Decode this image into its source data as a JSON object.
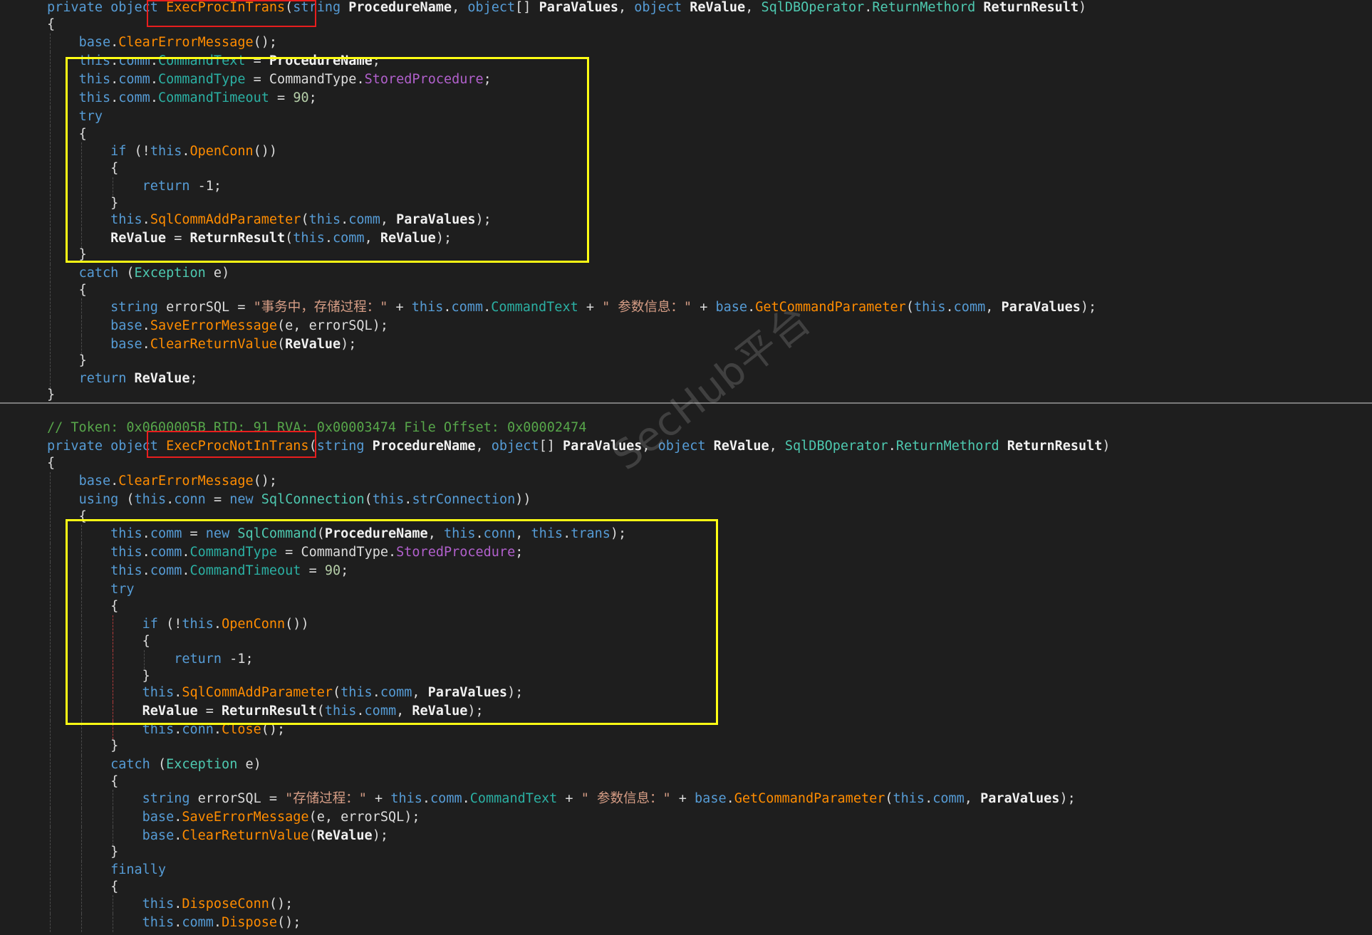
{
  "code": {
    "top": {
      "l01": {
        "kw_private": "private",
        "kw_object": "object",
        "method": "ExecProcInTrans",
        "p1_open": "(",
        "kw_string": "string",
        "arg1": "ProcedureName",
        "sep1": ", ",
        "kw_object2": "object",
        "brackets": "[]",
        "arg2": "ParaValues",
        "sep2": ", ",
        "kw_object3": "object",
        "arg3": "ReValue",
        "sep3": ", ",
        "type_op": "SqlDBOperator",
        "dot": ".",
        "type_rm": "ReturnMethord",
        "arg4": "ReturnResult",
        "close": ")"
      },
      "l02": "{",
      "l03": {
        "base": "base",
        "dot": ".",
        "method": "ClearErrorMessage",
        "tail": "();"
      },
      "l04": {
        "this": "this",
        "dot1": ".",
        "comm": "comm",
        "dot2": ".",
        "prop": "CommandText",
        "eq": " = ",
        "val": "ProcedureName",
        "tail": ";"
      },
      "l05": {
        "this": "this",
        "dot1": ".",
        "comm": "comm",
        "dot2": ".",
        "prop": "CommandType",
        "eq": " = ",
        "type": "CommandType",
        "dot3": ".",
        "member": "StoredProcedure",
        "tail": ";"
      },
      "l06": {
        "this": "this",
        "dot1": ".",
        "comm": "comm",
        "dot2": ".",
        "prop": "CommandTimeout",
        "eq": " = ",
        "num": "90",
        "tail": ";"
      },
      "l07": "try",
      "l08": "{",
      "l09": {
        "kw_if": "if",
        "open": " (!",
        "this": "this",
        "dot": ".",
        "method": "OpenConn",
        "tail": "())"
      },
      "l10": "{",
      "l11": {
        "kw_return": "return",
        "val": " -1;"
      },
      "l12": "}",
      "l13": {
        "this": "this",
        "dot": ".",
        "method": "SqlCommAddParameter",
        "open": "(",
        "this2": "this",
        "dot2": ".",
        "comm": "comm",
        "sep": ", ",
        "arg": "ParaValues",
        "tail": ");"
      },
      "l14": {
        "lhs": "ReValue",
        "eq": " = ",
        "method": "ReturnResult",
        "open": "(",
        "this": "this",
        "dot": ".",
        "comm": "comm",
        "sep": ", ",
        "arg": "ReValue",
        "tail": ");"
      },
      "l15": "}",
      "l16": {
        "kw_catch": "catch",
        "open": " (",
        "type": "Exception",
        "var": " e)"
      },
      "l17": "{",
      "l18": {
        "kw_string": "string",
        "var": " errorSQL = ",
        "str1": "\"事务中，存储过程：\"",
        "plus1": " + ",
        "this1": "this",
        "dot1": ".",
        "comm1": "comm",
        "dot2": ".",
        "prop": "CommandText",
        "plus2": " + ",
        "str2": "\" 参数信息：\"",
        "plus3": " + ",
        "base": "base",
        "dot3": ".",
        "method": "GetCommandParameter",
        "open": "(",
        "this2": "this",
        "dot4": ".",
        "comm2": "comm",
        "sep": ", ",
        "arg": "ParaValues",
        "tail": ");"
      },
      "l19": {
        "base": "base",
        "dot": ".",
        "method": "SaveErrorMessage",
        "args": "(e, errorSQL);"
      },
      "l20": {
        "base": "base",
        "dot": ".",
        "method": "ClearReturnValue",
        "open": "(",
        "arg": "ReValue",
        "tail": ");"
      },
      "l21": "}",
      "l22": {
        "kw_return": "return",
        "val": "ReValue",
        "tail": ";"
      },
      "l23": "}"
    },
    "bottom": {
      "l01": "// Token: 0x0600005B RID: 91 RVA: 0x00003474 File Offset: 0x00002474",
      "l02": {
        "kw_private": "private",
        "kw_object": "object",
        "method": "ExecProcNotInTrans",
        "p1_open": "(",
        "kw_string": "string",
        "arg1": "ProcedureName",
        "sep1": ", ",
        "kw_object2": "object",
        "brackets": "[]",
        "arg2": "ParaValues",
        "sep2": ", ",
        "kw_object3": "object",
        "arg3": "ReValue",
        "sep3": ", ",
        "type_op": "SqlDBOperator",
        "dot": ".",
        "type_rm": "ReturnMethord",
        "arg4": "ReturnResult",
        "close": ")"
      },
      "l03": "{",
      "l04": {
        "base": "base",
        "dot": ".",
        "method": "ClearErrorMessage",
        "tail": "();"
      },
      "l05": {
        "kw_using": "using",
        "open": " (",
        "this1": "this",
        "dot1": ".",
        "conn": "conn",
        "eq": " = ",
        "kw_new": "new",
        "type": " SqlConnection",
        "open2": "(",
        "this2": "this",
        "dot2": ".",
        "field": "strConnection",
        "tail": "))"
      },
      "l06": "{",
      "l07": {
        "this1": "this",
        "dot1": ".",
        "comm": "comm",
        "eq": " = ",
        "kw_new": "new",
        "type": " SqlCommand",
        "open": "(",
        "arg": "ProcedureName",
        "sep1": ", ",
        "this2": "this",
        "dot2": ".",
        "conn": "conn",
        "sep2": ", ",
        "this3": "this",
        "dot3": ".",
        "trans": "trans",
        "tail": ");"
      },
      "l08": {
        "this": "this",
        "dot1": ".",
        "comm": "comm",
        "dot2": ".",
        "prop": "CommandType",
        "eq": " = ",
        "type": "CommandType",
        "dot3": ".",
        "member": "StoredProcedure",
        "tail": ";"
      },
      "l09": {
        "this": "this",
        "dot1": ".",
        "comm": "comm",
        "dot2": ".",
        "prop": "CommandTimeout",
        "eq": " = ",
        "num": "90",
        "tail": ";"
      },
      "l10": "try",
      "l11": "{",
      "l12": {
        "kw_if": "if",
        "open": " (!",
        "this": "this",
        "dot": ".",
        "method": "OpenConn",
        "tail": "())"
      },
      "l13": "{",
      "l14": {
        "kw_return": "return",
        "val": " -1;"
      },
      "l15": "}",
      "l16": {
        "this": "this",
        "dot": ".",
        "method": "SqlCommAddParameter",
        "open": "(",
        "this2": "this",
        "dot2": ".",
        "comm": "comm",
        "sep": ", ",
        "arg": "ParaValues",
        "tail": ");"
      },
      "l17": {
        "lhs": "ReValue",
        "eq": " = ",
        "method": "ReturnResult",
        "open": "(",
        "this": "this",
        "dot": ".",
        "comm": "comm",
        "sep": ", ",
        "arg": "ReValue",
        "tail": ");"
      },
      "l18": {
        "this": "this",
        "dot1": ".",
        "conn": "conn",
        "dot2": ".",
        "method": "Close",
        "tail": "();"
      },
      "l19": "}",
      "l20": {
        "kw_catch": "catch",
        "open": " (",
        "type": "Exception",
        "var": " e)"
      },
      "l21": "{",
      "l22": {
        "kw_string": "string",
        "var": " errorSQL = ",
        "str1": "\"存储过程：\"",
        "plus1": " + ",
        "this1": "this",
        "dot1": ".",
        "comm1": "comm",
        "dot2": ".",
        "prop": "CommandText",
        "plus2": " + ",
        "str2": "\" 参数信息：\"",
        "plus3": " + ",
        "base": "base",
        "dot3": ".",
        "method": "GetCommandParameter",
        "open": "(",
        "this2": "this",
        "dot4": ".",
        "comm2": "comm",
        "sep": ", ",
        "arg": "ParaValues",
        "tail": ");"
      },
      "l23": {
        "base": "base",
        "dot": ".",
        "method": "SaveErrorMessage",
        "args": "(e, errorSQL);"
      },
      "l24": {
        "base": "base",
        "dot": ".",
        "method": "ClearReturnValue",
        "open": "(",
        "arg": "ReValue",
        "tail": ");"
      },
      "l25": "}",
      "l26": "finally",
      "l27": "{",
      "l28": {
        "this": "this",
        "dot": ".",
        "method": "DisposeConn",
        "tail": "();"
      },
      "l29": {
        "this": "this",
        "dot1": ".",
        "comm": "comm",
        "dot2": ".",
        "method": "Dispose",
        "tail": "();"
      }
    }
  },
  "watermark": "SecHub平台",
  "colors": {
    "background": "#1e1e1e",
    "keyword": "#569cd6",
    "method": "#ff8c00",
    "type": "#4ec9b0",
    "property": "#2bb0a3",
    "enum_member": "#b160cc",
    "string": "#d69d85",
    "comment": "#57a64a",
    "highlight_red": "#e81e1e",
    "highlight_yellow": "#ffff14"
  }
}
